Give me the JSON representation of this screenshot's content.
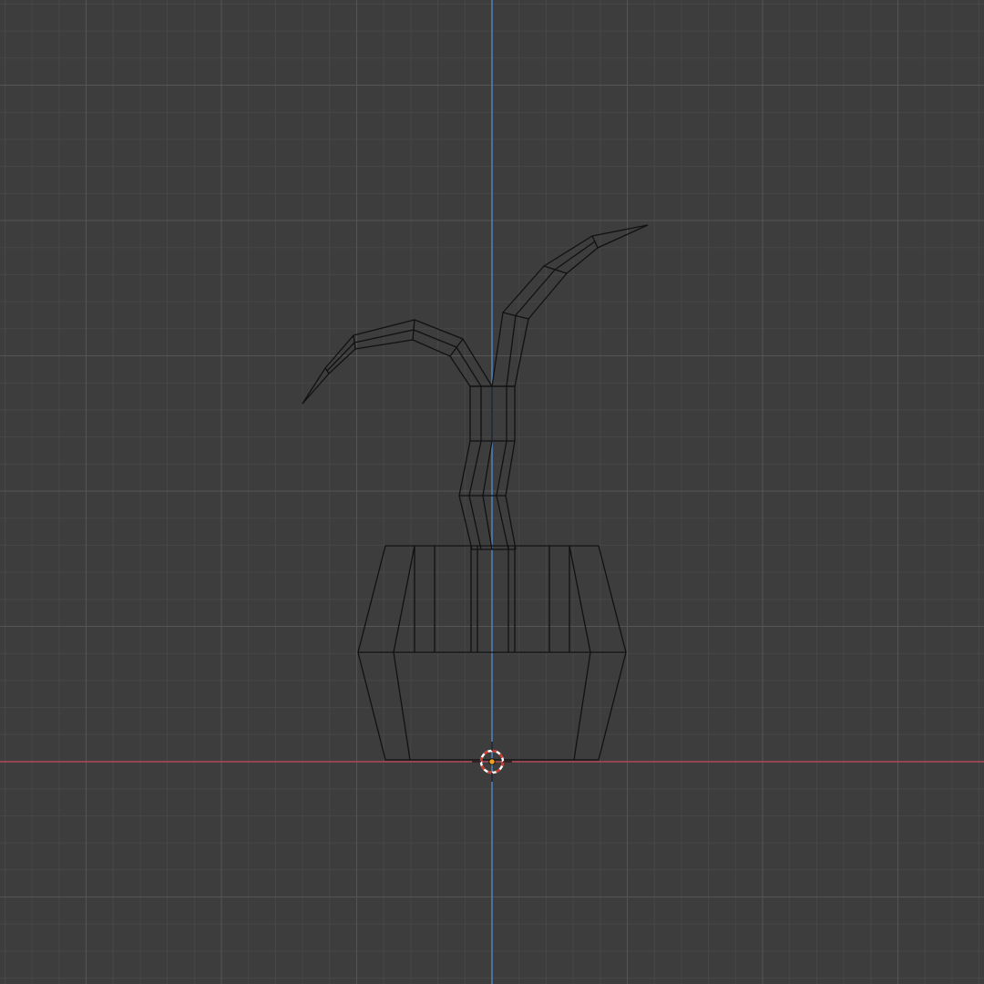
{
  "viewport": {
    "view": "front-orthographic",
    "shading": "wireframe",
    "background_color": "#3d3d3d",
    "grid_minor_color": "#474747",
    "grid_major_color": "#555555",
    "x_axis_color": "#b0485a",
    "z_axis_color": "#4f7fb8",
    "wire_color": "#111111",
    "cursor": {
      "name": "3d-cursor-icon",
      "ring_colors": [
        "#d0362a",
        "#ffffff"
      ],
      "origin_color": "#f0a020"
    },
    "object": {
      "name": "potted-plant-mesh",
      "parts": [
        "pot",
        "stem",
        "left-leaf",
        "right-leaf"
      ]
    }
  }
}
